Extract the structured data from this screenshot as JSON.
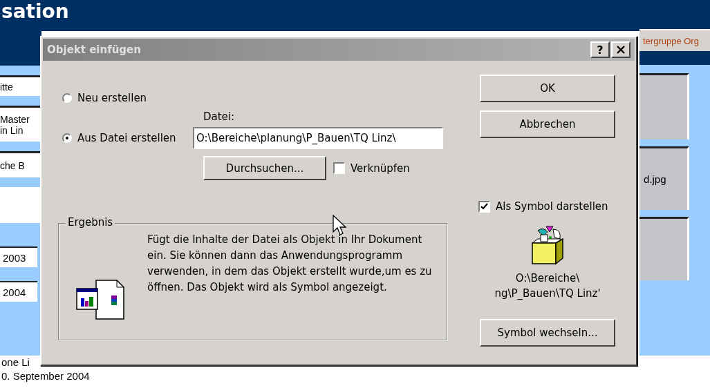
{
  "background": {
    "header_title": "sation",
    "tab": "tergruppe Org",
    "left_cells": [
      "itte",
      "Master",
      "in Lin",
      "che B"
    ],
    "year_fields": [
      "2003",
      "2004"
    ],
    "right_cell": "d.jpg",
    "footer_lines": [
      "one Li",
      "0. September 2004"
    ]
  },
  "dialog": {
    "title": "Objekt einfügen",
    "help_button": "?",
    "options": [
      {
        "label": "Neu erstellen",
        "selected": false
      },
      {
        "label": "Aus Datei erstellen",
        "selected": true
      }
    ],
    "file": {
      "label": "Datei:",
      "value": "O:\\Bereiche\\planung\\P_Bauen\\TQ Linz\\"
    },
    "browse_button": "Durchsuchen...",
    "link": {
      "label": "Verknüpfen",
      "checked": false
    },
    "buttons": [
      "OK",
      "Abbrechen"
    ],
    "as_icon": {
      "label": "Als Symbol darstellen",
      "checked": true
    },
    "icon_caption": [
      "O:\\Bereiche\\",
      "ng\\P_Bauen\\TQ Linz'"
    ],
    "change_icon_button": "Symbol wechseln...",
    "result": {
      "title": "Ergebnis",
      "text": "Fügt die Inhalte der Datei als Objekt in Ihr Dokument ein. Sie können dann das Anwendungsprogramm verwenden, in dem das Objekt erstellt wurde,um es zu öffnen. Das Objekt wird als Symbol angezeigt."
    }
  }
}
